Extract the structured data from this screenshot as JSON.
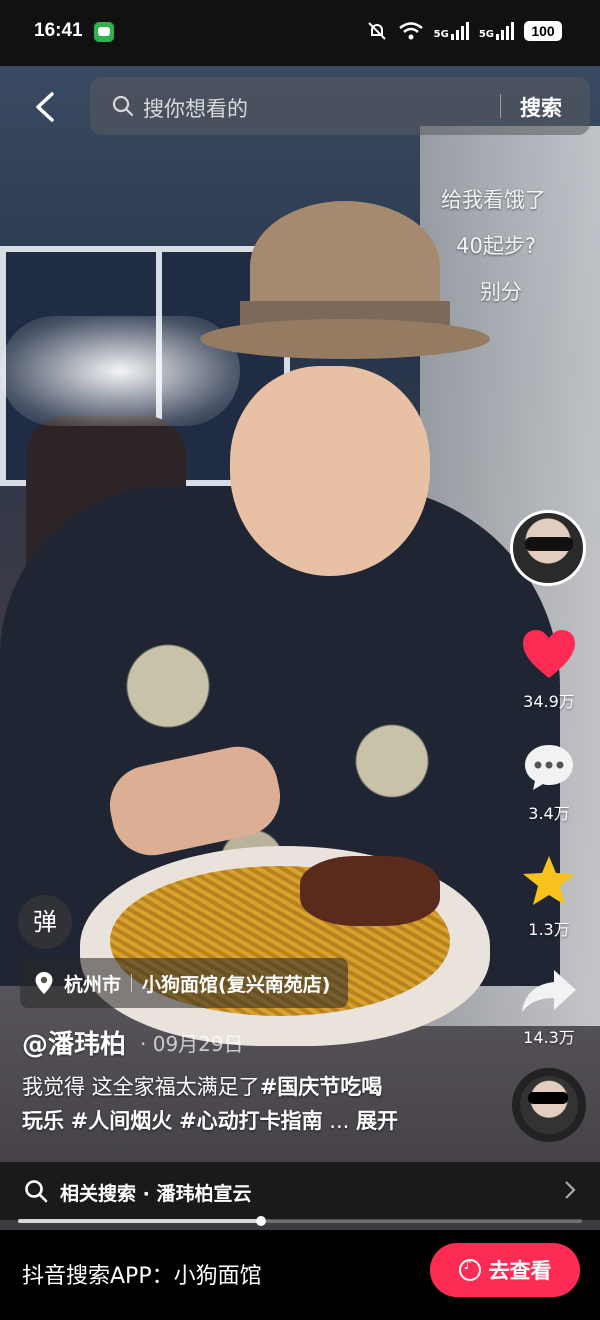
{
  "status_bar": {
    "time": "16:41",
    "network_1": "5G",
    "network_2": "5G",
    "battery": "100"
  },
  "top_nav": {
    "search_placeholder": "搜你想看的",
    "search_button": "搜索"
  },
  "captions": [
    "给我看饿了",
    "40起步?",
    "别分"
  ],
  "right_rail": {
    "likes": "34.9万",
    "comments": "3.4万",
    "favorites": "1.3万",
    "shares": "14.3万",
    "like_color": "#fe2c55",
    "favorite_color": "#f8c21c"
  },
  "danmu": {
    "label": "弹"
  },
  "location": {
    "city": "杭州市",
    "place": "小狗面馆(复兴南苑店)"
  },
  "post": {
    "author": "@潘玮柏",
    "date": "· 09月29日",
    "desc_text": "我觉得 这全家福太满足了",
    "tag1": "#国庆节吃喝",
    "tag1_cont": "玩乐",
    "tag2": "#人间烟火",
    "tag3": "#心动打卡指南",
    "ellipsis": "...",
    "expand": "展开"
  },
  "related_search": {
    "text": "相关搜索 · 潘玮柏宣云"
  },
  "progress": {
    "fraction": 0.43
  },
  "bottom_banner": {
    "text": "抖音搜索APP：小狗面馆",
    "button": "去查看",
    "button_color": "#fe2c55"
  }
}
